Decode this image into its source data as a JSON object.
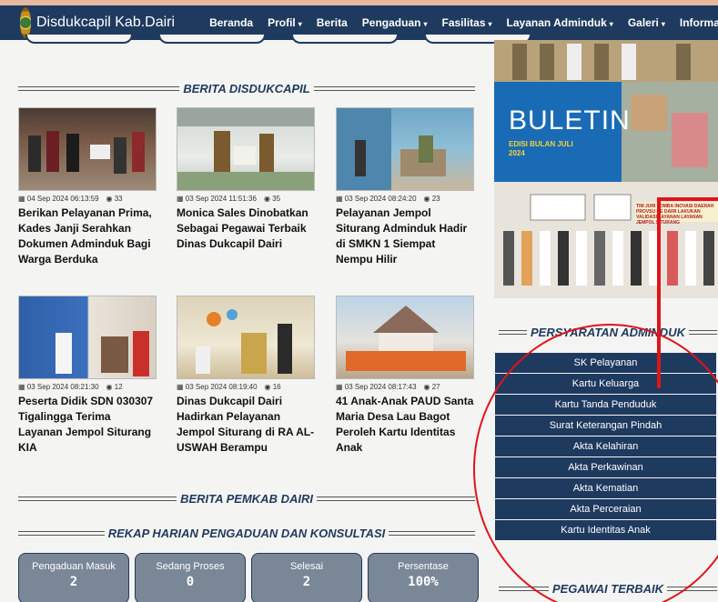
{
  "header": {
    "brand": "Disdukcapil Kab.Dairi",
    "nav": [
      {
        "label": "Beranda",
        "dropdown": false
      },
      {
        "label": "Profil",
        "dropdown": true
      },
      {
        "label": "Berita",
        "dropdown": false
      },
      {
        "label": "Pengaduan",
        "dropdown": true
      },
      {
        "label": "Fasilitas",
        "dropdown": true
      },
      {
        "label": "Layanan Adminduk",
        "dropdown": true
      },
      {
        "label": "Galeri",
        "dropdown": true
      },
      {
        "label": "Informasi",
        "dropdown": true
      }
    ]
  },
  "sections": {
    "berita": "BERITA DISDUKCAPIL",
    "pemkab": "BERITA PEMKAB DAIRI",
    "rekap": "REKAP HARIAN PENGADUAN DAN KONSULTASI",
    "persyaratan": "PERSYARATAN ADMINDUK",
    "pegawai": "PEGAWAI TERBAIK"
  },
  "news": [
    {
      "date": "04 Sep 2024 06:13:59",
      "views": "33",
      "title": "Berikan Pelayanan Prima, Kades Janji Serahkan Dokumen Adminduk Bagi Warga Berduka"
    },
    {
      "date": "03 Sep 2024 11:51:36",
      "views": "35",
      "title": "Monica Sales Dinobatkan Sebagai Pegawai Terbaik Dinas Dukcapil Dairi"
    },
    {
      "date": "03 Sep 2024 08:24:20",
      "views": "23",
      "title": "Pelayanan Jempol Siturang Adminduk Hadir di SMKN 1 Siempat Nempu Hilir"
    },
    {
      "date": "03 Sep 2024 08:21:30",
      "views": "12",
      "title": "Peserta Didik SDN 030307 Tigalingga Terima Layanan Jempol Siturang KIA"
    },
    {
      "date": "03 Sep 2024 08:19:40",
      "views": "16",
      "title": "Dinas Dukcapil Dairi Hadirkan Pelayanan Jempol Siturang di RA AL-USWAH Berampu"
    },
    {
      "date": "03 Sep 2024 08:17:43",
      "views": "27",
      "title": "41 Anak-Anak PAUD Santa Maria Desa Lau Bagot Peroleh Kartu Identitas Anak"
    }
  ],
  "rekap": [
    {
      "label": "Pengaduan Masuk",
      "value": "2"
    },
    {
      "label": "Sedang Proses",
      "value": "0"
    },
    {
      "label": "Selesai",
      "value": "2"
    },
    {
      "label": "Persentase",
      "value": "100%"
    }
  ],
  "banner": {
    "title": "BULETIN",
    "sub": "EDISI BULAN JULI 2024",
    "note": "TIM JURI LOMBA INOVASI DAERAH PROVSU KE DAIRI LAKUKAN VALIDASI LAYANAN LAYANAN JEMPOL SITURANG"
  },
  "persyaratan": [
    "SK Pelayanan",
    "Kartu Keluarga",
    "Kartu Tanda Penduduk",
    "Surat Keterangan Pindah",
    "Akta Kelahiran",
    "Akta Perkawinan",
    "Akta Kematian",
    "Akta Perceraian",
    "Kartu Identitas Anak"
  ],
  "icons": {
    "calendar": "calendar-icon",
    "views": "eye-icon",
    "logo": "dairi-seal"
  },
  "colors": {
    "nav": "#1f3a5f",
    "button": "#1f3a5f",
    "rekap_box": "#7a8797",
    "annotation": "#e0141a"
  }
}
